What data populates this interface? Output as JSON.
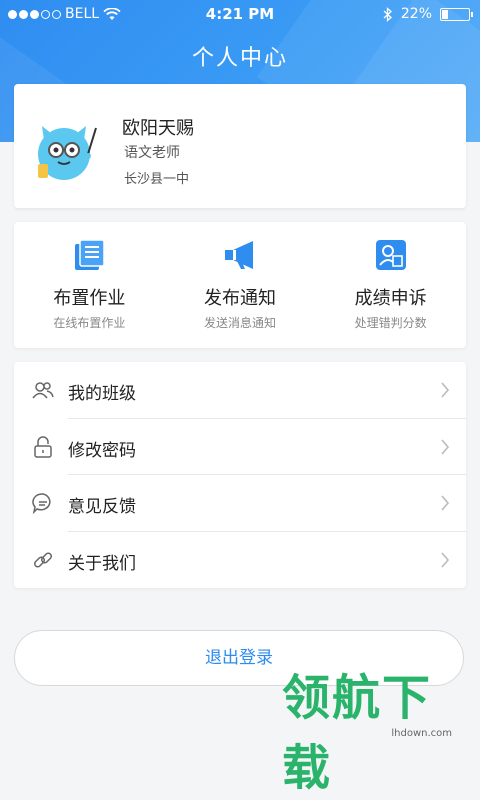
{
  "status_bar": {
    "carrier": "BELL",
    "time": "4:21 PM",
    "battery_text": "22%",
    "battery_level": 0.22,
    "signal_bars_filled": 3,
    "signal_bars_total": 5
  },
  "header": {
    "title": "个人中心"
  },
  "profile": {
    "name": "欧阳天赐",
    "role": "语文老师",
    "school": "长沙县一中"
  },
  "actions": [
    {
      "title": "布置作业",
      "subtitle": "在线布置作业",
      "icon": "homework-icon"
    },
    {
      "title": "发布通知",
      "subtitle": "发送消息通知",
      "icon": "megaphone-icon"
    },
    {
      "title": "成绩申诉",
      "subtitle": "处理错判分数",
      "icon": "appeal-icon"
    }
  ],
  "menu": [
    {
      "label": "我的班级",
      "icon": "users-icon"
    },
    {
      "label": "修改密码",
      "icon": "lock-icon"
    },
    {
      "label": "意见反馈",
      "icon": "feedback-icon"
    },
    {
      "label": "关于我们",
      "icon": "link-icon"
    }
  ],
  "logout_label": "退出登录",
  "watermark": {
    "brand": "领航下载",
    "url": "lhdown.com"
  },
  "colors": {
    "primary": "#2f8df0",
    "accent_text": "#2d8cf0",
    "watermark_green": "#29b36b"
  }
}
